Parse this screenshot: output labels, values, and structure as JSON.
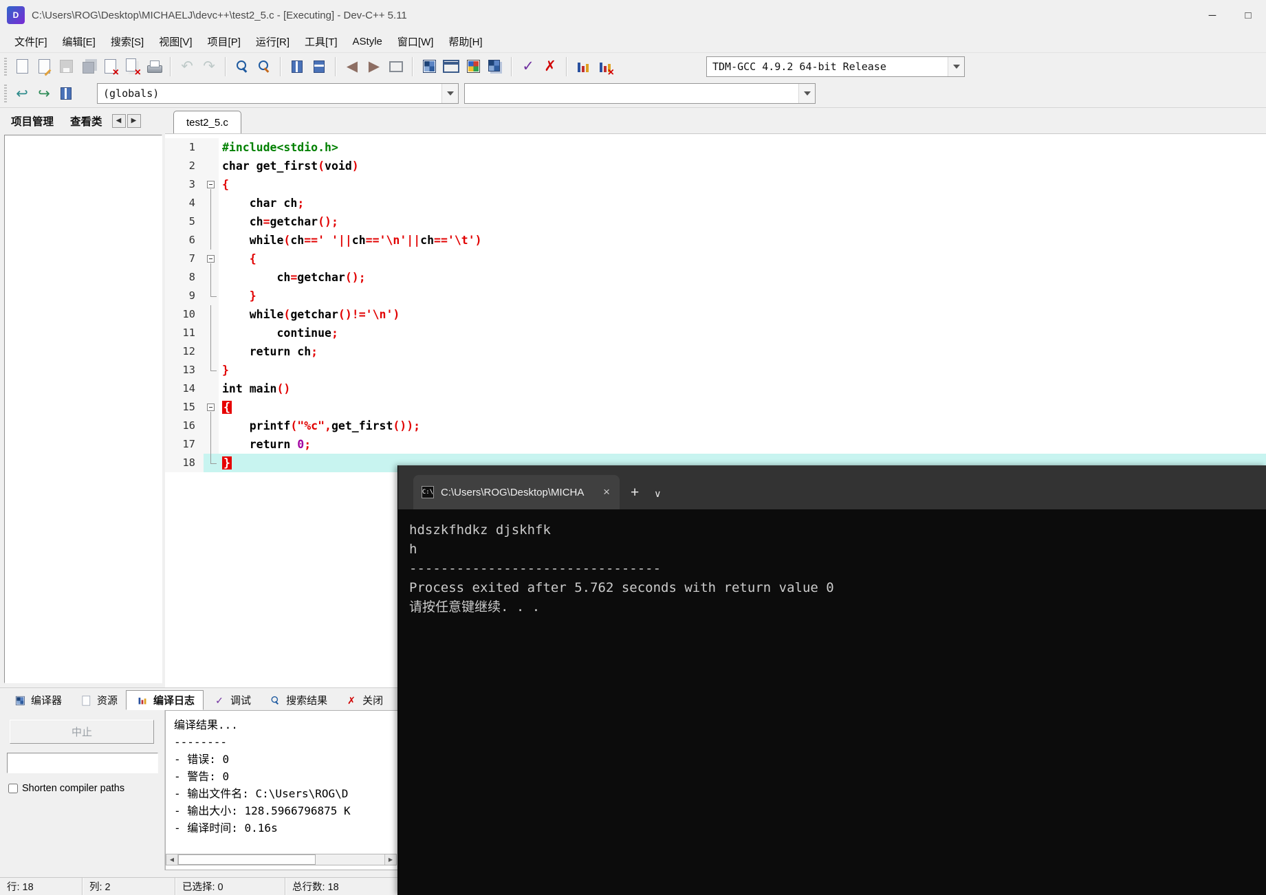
{
  "window": {
    "title": "C:\\Users\\ROG\\Desktop\\MICHAELJ\\devc++\\test2_5.c - [Executing] - Dev-C++ 5.11",
    "app_initial": "D",
    "controls": {
      "minimize": "─",
      "maximize": "□"
    }
  },
  "menubar": [
    {
      "key": "file",
      "label": "文件[F]"
    },
    {
      "key": "edit",
      "label": "编辑[E]"
    },
    {
      "key": "search",
      "label": "搜索[S]"
    },
    {
      "key": "view",
      "label": "视图[V]"
    },
    {
      "key": "project",
      "label": "项目[P]"
    },
    {
      "key": "run",
      "label": "运行[R]"
    },
    {
      "key": "tools",
      "label": "工具[T]"
    },
    {
      "key": "astyle",
      "label": "AStyle"
    },
    {
      "key": "window",
      "label": "窗口[W]"
    },
    {
      "key": "help",
      "label": "帮助[H]"
    }
  ],
  "toolbar_main": {
    "items": [
      {
        "name": "new-file",
        "kind": "page"
      },
      {
        "name": "open-file",
        "kind": "page-edit"
      },
      {
        "name": "save-file",
        "kind": "floppy",
        "grayed": true
      },
      {
        "name": "save-all",
        "kind": "floppy2",
        "grayed": true
      },
      {
        "name": "close-file",
        "kind": "page-x"
      },
      {
        "name": "close-all",
        "kind": "page-x2"
      },
      {
        "name": "print",
        "kind": "printer"
      },
      {
        "sep": true
      },
      {
        "name": "undo",
        "kind": "glyph",
        "glyph": "↶",
        "color": "#7fb2ad",
        "grayed": true
      },
      {
        "name": "redo",
        "kind": "glyph",
        "glyph": "↷",
        "color": "#7fb2ad",
        "grayed": true
      },
      {
        "sep": true
      },
      {
        "name": "find",
        "kind": "lens"
      },
      {
        "name": "replace",
        "kind": "lens-pencil"
      },
      {
        "sep": true
      },
      {
        "name": "goto-function",
        "kind": "columns"
      },
      {
        "name": "goto-line",
        "kind": "columns2"
      },
      {
        "sep": true
      },
      {
        "name": "back",
        "kind": "glyph",
        "glyph": "◀",
        "color": "#8d6e63"
      },
      {
        "name": "forward",
        "kind": "glyph",
        "glyph": "▶",
        "color": "#8d6e63"
      },
      {
        "name": "fullscreen",
        "kind": "eject"
      },
      {
        "sep": true
      },
      {
        "name": "compile",
        "kind": "grid-blue"
      },
      {
        "name": "run",
        "kind": "window"
      },
      {
        "name": "compile-run",
        "kind": "grid-color"
      },
      {
        "name": "rebuild-all",
        "kind": "grid-blue2"
      },
      {
        "sep": true
      },
      {
        "name": "syntax-check",
        "kind": "glyph",
        "glyph": "✓",
        "color": "#7030a0"
      },
      {
        "name": "stop-execution",
        "kind": "glyph",
        "glyph": "✗",
        "color": "#d00000"
      },
      {
        "sep": true
      },
      {
        "name": "profile",
        "kind": "bars"
      },
      {
        "name": "delete-profiling",
        "kind": "bars-x"
      }
    ],
    "compiler_combo": "TDM-GCC 4.9.2 64-bit Release"
  },
  "toolbar_class": {
    "items": [
      {
        "name": "goto-declaration",
        "kind": "glyph",
        "glyph": "↩",
        "color": "#2e8b8b"
      },
      {
        "name": "goto-implementation",
        "kind": "glyph",
        "glyph": "↪",
        "color": "#2e8b57"
      },
      {
        "name": "class-browser",
        "kind": "columns"
      }
    ],
    "globals_combo": "(globals)",
    "members_combo": ""
  },
  "left_pane": {
    "tabs": [
      {
        "key": "project-manager",
        "label": "项目管理"
      },
      {
        "key": "class-view",
        "label": "查看类"
      }
    ],
    "scroll_left": "◀",
    "scroll_right": "▶"
  },
  "editor": {
    "tab": "test2_5.c",
    "current_line": 18,
    "lines": [
      {
        "n": 1,
        "fold": "",
        "tokens": [
          {
            "c": "pp",
            "t": "#include<stdio.h>"
          }
        ]
      },
      {
        "n": 2,
        "fold": "",
        "tokens": [
          {
            "c": "kw",
            "t": "char"
          },
          {
            "c": "id",
            "t": " get_first"
          },
          {
            "c": "sym",
            "t": "("
          },
          {
            "c": "kw",
            "t": "void"
          },
          {
            "c": "sym",
            "t": ")"
          }
        ]
      },
      {
        "n": 3,
        "fold": "start",
        "tokens": [
          {
            "c": "sym",
            "t": "{"
          }
        ]
      },
      {
        "n": 4,
        "fold": "line",
        "tokens": [
          {
            "c": "id",
            "t": "    "
          },
          {
            "c": "kw",
            "t": "char"
          },
          {
            "c": "id",
            "t": " ch"
          },
          {
            "c": "sym",
            "t": ";"
          }
        ]
      },
      {
        "n": 5,
        "fold": "line",
        "tokens": [
          {
            "c": "id",
            "t": "    ch"
          },
          {
            "c": "sym",
            "t": "="
          },
          {
            "c": "id",
            "t": "getchar"
          },
          {
            "c": "sym",
            "t": "();"
          }
        ]
      },
      {
        "n": 6,
        "fold": "line",
        "tokens": [
          {
            "c": "id",
            "t": "    "
          },
          {
            "c": "kw",
            "t": "while"
          },
          {
            "c": "sym",
            "t": "("
          },
          {
            "c": "id",
            "t": "ch"
          },
          {
            "c": "sym",
            "t": "=="
          },
          {
            "c": "str",
            "t": "' '"
          },
          {
            "c": "sym",
            "t": "||"
          },
          {
            "c": "id",
            "t": "ch"
          },
          {
            "c": "sym",
            "t": "=="
          },
          {
            "c": "str",
            "t": "'\\n'"
          },
          {
            "c": "sym",
            "t": "||"
          },
          {
            "c": "id",
            "t": "ch"
          },
          {
            "c": "sym",
            "t": "=="
          },
          {
            "c": "str",
            "t": "'\\t'"
          },
          {
            "c": "sym",
            "t": ")"
          }
        ]
      },
      {
        "n": 7,
        "fold": "start",
        "tokens": [
          {
            "c": "id",
            "t": "    "
          },
          {
            "c": "sym",
            "t": "{"
          }
        ]
      },
      {
        "n": 8,
        "fold": "line",
        "tokens": [
          {
            "c": "id",
            "t": "        ch"
          },
          {
            "c": "sym",
            "t": "="
          },
          {
            "c": "id",
            "t": "getchar"
          },
          {
            "c": "sym",
            "t": "();"
          }
        ]
      },
      {
        "n": 9,
        "fold": "end",
        "tokens": [
          {
            "c": "id",
            "t": "    "
          },
          {
            "c": "sym",
            "t": "}"
          }
        ]
      },
      {
        "n": 10,
        "fold": "line",
        "tokens": [
          {
            "c": "id",
            "t": "    "
          },
          {
            "c": "kw",
            "t": "while"
          },
          {
            "c": "sym",
            "t": "("
          },
          {
            "c": "id",
            "t": "getchar"
          },
          {
            "c": "sym",
            "t": "()!="
          },
          {
            "c": "str",
            "t": "'\\n'"
          },
          {
            "c": "sym",
            "t": ")"
          }
        ]
      },
      {
        "n": 11,
        "fold": "line",
        "tokens": [
          {
            "c": "id",
            "t": "        "
          },
          {
            "c": "kw",
            "t": "continue"
          },
          {
            "c": "sym",
            "t": ";"
          }
        ]
      },
      {
        "n": 12,
        "fold": "line",
        "tokens": [
          {
            "c": "id",
            "t": "    "
          },
          {
            "c": "kw",
            "t": "return"
          },
          {
            "c": "id",
            "t": " ch"
          },
          {
            "c": "sym",
            "t": ";"
          }
        ]
      },
      {
        "n": 13,
        "fold": "end",
        "tokens": [
          {
            "c": "sym",
            "t": "}"
          }
        ]
      },
      {
        "n": 14,
        "fold": "",
        "tokens": [
          {
            "c": "kw",
            "t": "int"
          },
          {
            "c": "id",
            "t": " main"
          },
          {
            "c": "sym",
            "t": "()"
          }
        ]
      },
      {
        "n": 15,
        "fold": "start",
        "tokens": [
          {
            "c": "hl",
            "t": "{"
          }
        ]
      },
      {
        "n": 16,
        "fold": "line",
        "tokens": [
          {
            "c": "id",
            "t": "    printf"
          },
          {
            "c": "sym",
            "t": "("
          },
          {
            "c": "str",
            "t": "\"%c\""
          },
          {
            "c": "sym",
            "t": ","
          },
          {
            "c": "id",
            "t": "get_first"
          },
          {
            "c": "sym",
            "t": "());"
          }
        ]
      },
      {
        "n": 17,
        "fold": "line",
        "tokens": [
          {
            "c": "id",
            "t": "    "
          },
          {
            "c": "kw",
            "t": "return"
          },
          {
            "c": "num",
            "t": " 0"
          },
          {
            "c": "sym",
            "t": ";"
          }
        ]
      },
      {
        "n": 18,
        "fold": "end",
        "tokens": [
          {
            "c": "hl",
            "t": "}"
          }
        ]
      }
    ]
  },
  "bottom": {
    "tabs": [
      {
        "key": "compiler",
        "label": "编译器",
        "icon": "grid-blue"
      },
      {
        "key": "resources",
        "label": "资源",
        "icon": "page"
      },
      {
        "key": "compile-log",
        "label": "编译日志",
        "icon": "bars",
        "active": true
      },
      {
        "key": "debug",
        "label": "调试",
        "icon": "check",
        "glyph": "✓",
        "color": "#7030a0"
      },
      {
        "key": "search-results",
        "label": "搜索结果",
        "icon": "lens"
      },
      {
        "key": "close",
        "label": "关闭",
        "icon": "cross",
        "glyph": "✗",
        "color": "#d00000"
      }
    ],
    "abort_button": "中止",
    "shorten_label": "Shorten compiler paths",
    "log_lines": [
      "编译结果...",
      "--------",
      "- 错误: 0",
      "- 警告: 0",
      "- 输出文件名: C:\\Users\\ROG\\D",
      "- 输出大小: 128.5966796875 K",
      "- 编译时间: 0.16s"
    ]
  },
  "statusbar": [
    {
      "key": "line",
      "label": "行:  18"
    },
    {
      "key": "column",
      "label": "列:  2"
    },
    {
      "key": "selected",
      "label": "已选择:  0"
    },
    {
      "key": "total-lines",
      "label": "总行数:  18"
    }
  ],
  "terminal": {
    "tab_title": "C:\\Users\\ROG\\Desktop\\MICHA",
    "tab_icon_text": "C:\\",
    "close_glyph": "×",
    "new_tab_glyph": "+",
    "chevron_glyph": "∨",
    "lines": [
      "hdszkfhdkz djskhfk",
      "h",
      "--------------------------------",
      "Process exited after 5.762 seconds with return value 0",
      "请按任意键继续. . ."
    ]
  },
  "colors": {
    "preprocessor": "#008000",
    "symbol": "#e10000",
    "string": "#e10000",
    "number": "#a100a1",
    "current_line_bg": "#c8f4f0",
    "brace_match_bg": "#e60000",
    "terminal_bg": "#0c0c0c",
    "terminal_fg": "#cccccc"
  }
}
